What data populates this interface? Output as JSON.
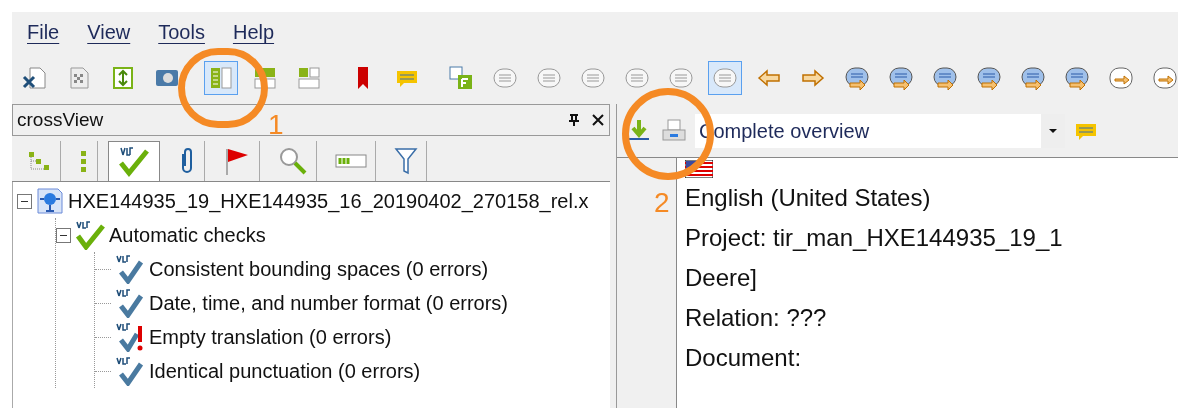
{
  "menu": [
    "File",
    "View",
    "Tools",
    "Help"
  ],
  "toolbar": [
    {
      "kind": "close-doc",
      "selected": false
    },
    {
      "kind": "doc",
      "selected": false
    },
    {
      "kind": "import",
      "selected": false
    },
    {
      "kind": "camera",
      "selected": false
    },
    {
      "kind": "separator"
    },
    {
      "kind": "columns",
      "selected": true
    },
    {
      "kind": "rows",
      "selected": false
    },
    {
      "kind": "grid",
      "selected": false
    },
    {
      "kind": "separator"
    },
    {
      "kind": "bookmark",
      "selected": false
    },
    {
      "kind": "comment",
      "selected": false
    },
    {
      "kind": "separator"
    },
    {
      "kind": "letter",
      "selected": false
    },
    {
      "kind": "round",
      "selected": false
    },
    {
      "kind": "round",
      "selected": false
    },
    {
      "kind": "round",
      "selected": false
    },
    {
      "kind": "round",
      "selected": false
    },
    {
      "kind": "round",
      "selected": false
    },
    {
      "kind": "round",
      "selected": true
    },
    {
      "kind": "arrow-left",
      "selected": false
    },
    {
      "kind": "arrow-right",
      "selected": false
    },
    {
      "kind": "round-blue",
      "selected": false
    },
    {
      "kind": "round-blue",
      "selected": false
    },
    {
      "kind": "round-blue",
      "selected": false
    },
    {
      "kind": "round-blue",
      "selected": false
    },
    {
      "kind": "round-blue",
      "selected": false
    },
    {
      "kind": "round-blue",
      "selected": false
    },
    {
      "kind": "round-white",
      "selected": false
    },
    {
      "kind": "round-white",
      "selected": false
    }
  ],
  "left_panel": {
    "title": "crossView",
    "tabs": [
      {
        "kind": "tree",
        "selected": false
      },
      {
        "kind": "list",
        "selected": false
      },
      {
        "kind": "check",
        "selected": true
      },
      {
        "kind": "clip",
        "selected": false
      },
      {
        "kind": "flag",
        "selected": false
      },
      {
        "kind": "search",
        "selected": false
      },
      {
        "kind": "bar",
        "selected": false
      },
      {
        "kind": "filter",
        "selected": false
      }
    ],
    "tree": [
      {
        "label": "HXE144935_19_HXE144935_16_20190402_270158_rel.x",
        "kind": "file",
        "expanded": true,
        "children": [
          {
            "label": "Automatic checks",
            "kind": "checks",
            "expanded": true,
            "children": [
              {
                "label": "Consistent bounding spaces (0 errors)",
                "kind": "check"
              },
              {
                "label": "Date, time, and number format (0 errors)",
                "kind": "check"
              },
              {
                "label": "Empty translation (0 errors)",
                "kind": "alert"
              },
              {
                "label": "Identical punctuation (0 errors)",
                "kind": "check"
              }
            ]
          }
        ]
      }
    ]
  },
  "right_panel": {
    "view": "Complete overview",
    "lines": [
      "English (United States)",
      "Project: tir_man_HXE144935_19_1",
      "Deere]",
      "Relation: ???",
      "Document:"
    ]
  },
  "annotations": [
    "1",
    "2"
  ]
}
